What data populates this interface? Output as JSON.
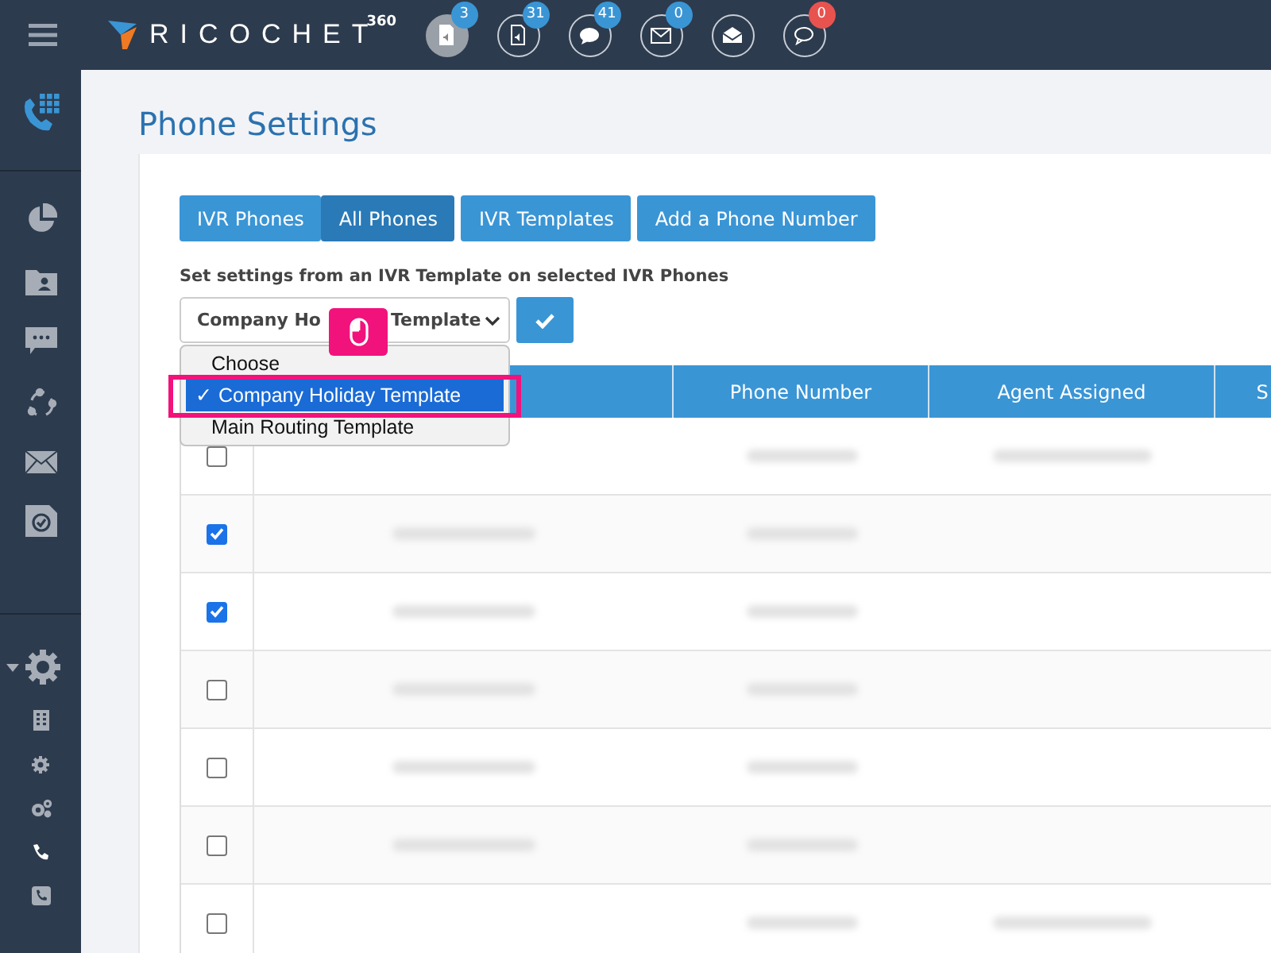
{
  "topbar": {
    "logo_text": "RICOCHET",
    "logo_suffix": "360",
    "icons": [
      {
        "kind": "voicemail",
        "badge": "3",
        "color": "#3a95d5",
        "selected": true
      },
      {
        "kind": "voicemail",
        "badge": "31",
        "color": "#3a95d5",
        "selected": false
      },
      {
        "kind": "chat",
        "badge": "41",
        "color": "#3a95d5",
        "selected": false
      },
      {
        "kind": "mail",
        "badge": "0",
        "color": "#3a95d5",
        "selected": false
      },
      {
        "kind": "open-mail",
        "selected": false
      },
      {
        "kind": "comment",
        "badge": "0",
        "color": "#e8534f",
        "selected": false
      }
    ]
  },
  "sidebar": {
    "top": [
      {
        "kind": "phone-keypad",
        "selected": true
      }
    ],
    "main": [
      {
        "kind": "pie"
      },
      {
        "kind": "contact"
      },
      {
        "kind": "chat"
      },
      {
        "kind": "share"
      },
      {
        "kind": "mail"
      },
      {
        "kind": "task"
      }
    ],
    "settings": {
      "expanded": true,
      "items": [
        {
          "kind": "building"
        },
        {
          "kind": "gear"
        },
        {
          "kind": "gears"
        },
        {
          "kind": "phone"
        },
        {
          "kind": "phone-square"
        }
      ]
    }
  },
  "page": {
    "title": "Phone Settings",
    "tabs": [
      {
        "label": "IVR Phones",
        "selected": false
      },
      {
        "label": "All Phones",
        "selected": true
      },
      {
        "label": "IVR Templates",
        "selected": false
      },
      {
        "label": "Add a Phone Number",
        "selected": false
      }
    ],
    "template_label": "Set settings from an IVR Template on selected IVR Phones",
    "template_select": {
      "value": "Company Ho",
      "value_tail": "Template",
      "expanded": true,
      "options": [
        {
          "label": "Choose",
          "selected": false
        },
        {
          "label": "Company Holiday Template",
          "selected": true,
          "check": "✓"
        },
        {
          "label": "Main Routing Template",
          "selected": false
        }
      ]
    },
    "highlight_tooltip": {
      "kind": "mouse-click"
    }
  },
  "table": {
    "columns": [
      "Phone Number",
      "Agent Assigned",
      "S"
    ],
    "rows": [
      {
        "checked": false,
        "blurred": [
          false,
          true,
          true,
          false
        ]
      },
      {
        "checked": true,
        "blurred": [
          true,
          true,
          false,
          false
        ]
      },
      {
        "checked": true,
        "blurred": [
          true,
          true,
          false,
          false
        ]
      },
      {
        "checked": false,
        "blurred": [
          true,
          true,
          false,
          false
        ]
      },
      {
        "checked": false,
        "blurred": [
          true,
          true,
          false,
          false
        ]
      },
      {
        "checked": false,
        "blurred": [
          true,
          true,
          false,
          false
        ]
      },
      {
        "checked": false,
        "blurred": [
          false,
          true,
          true,
          false
        ]
      }
    ]
  }
}
